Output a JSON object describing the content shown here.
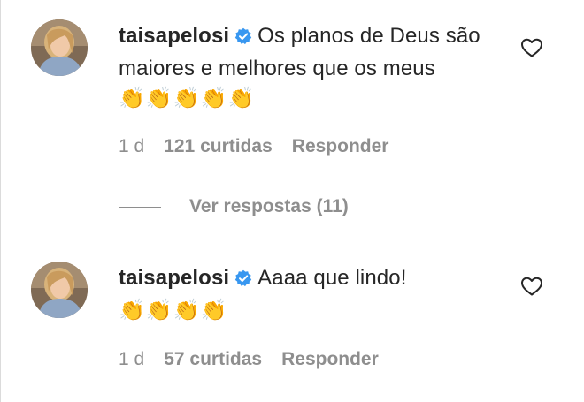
{
  "comments": [
    {
      "username": "taisapelosi",
      "text": "Os planos de Deus são maiores e melhores que os meus",
      "emoji": "👏👏👏👏👏",
      "time": "1 d",
      "likes": "121 curtidas",
      "reply": "Responder",
      "view_replies": "Ver respostas (11)"
    },
    {
      "username": "taisapelosi",
      "text": "Aaaa que lindo!",
      "emoji": "👏👏👏👏",
      "time": "1 d",
      "likes": "57 curtidas",
      "reply": "Responder"
    }
  ],
  "colors": {
    "text": "#262626",
    "secondary": "#8e8e8e",
    "verified": "#3897f0"
  },
  "icons": {
    "verified": "verified-badge-icon",
    "like": "heart-outline-icon"
  }
}
